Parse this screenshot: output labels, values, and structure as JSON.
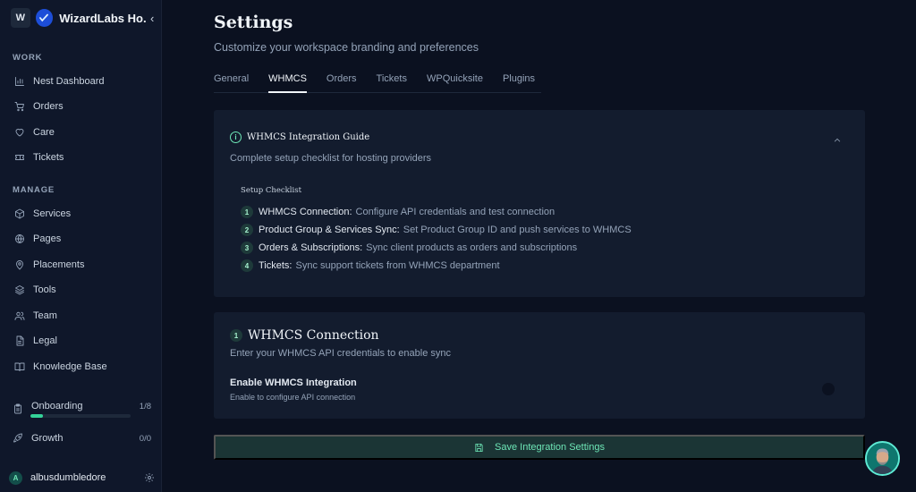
{
  "sidebar": {
    "workspace_badge": "W",
    "workspace_name": "WizardLabs Ho...",
    "collapse_glyph": "‹",
    "sections": {
      "work": "WORK",
      "manage": "MANAGE"
    },
    "work_items": [
      {
        "label": "Nest Dashboard",
        "icon": "bar-chart-icon"
      },
      {
        "label": "Orders",
        "icon": "cart-icon"
      },
      {
        "label": "Care",
        "icon": "heart-icon"
      },
      {
        "label": "Tickets",
        "icon": "ticket-icon"
      }
    ],
    "manage_items": [
      {
        "label": "Services",
        "icon": "box-icon"
      },
      {
        "label": "Pages",
        "icon": "globe-icon"
      },
      {
        "label": "Placements",
        "icon": "map-pin-icon"
      },
      {
        "label": "Tools",
        "icon": "layers-icon"
      },
      {
        "label": "Team",
        "icon": "users-icon"
      },
      {
        "label": "Legal",
        "icon": "file-icon"
      },
      {
        "label": "Knowledge Base",
        "icon": "book-icon"
      }
    ],
    "onboarding": {
      "label": "Onboarding",
      "count": "1/8",
      "progress": 0.125
    },
    "growth": {
      "label": "Growth",
      "count": "0/0"
    },
    "user": {
      "initial": "A",
      "name": "albusdumbledore"
    }
  },
  "header": {
    "title": "Settings",
    "subtitle": "Customize your workspace branding and preferences"
  },
  "tabs": [
    {
      "label": "General",
      "active": false
    },
    {
      "label": "WHMCS",
      "active": true
    },
    {
      "label": "Orders",
      "active": false
    },
    {
      "label": "Tickets",
      "active": false
    },
    {
      "label": "WPQuicksite",
      "active": false
    },
    {
      "label": "Plugins",
      "active": false
    }
  ],
  "guide": {
    "info_glyph": "i",
    "title": "WHMCS Integration Guide",
    "description": "Complete setup checklist for hosting providers",
    "checklist_title": "Setup Checklist",
    "steps": [
      {
        "num": "1",
        "bold": "WHMCS Connection:",
        "text": "Configure API credentials and test connection"
      },
      {
        "num": "2",
        "bold": "Product Group & Services Sync:",
        "text": "Set Product Group ID and push services to WHMCS"
      },
      {
        "num": "3",
        "bold": "Orders & Subscriptions:",
        "text": "Sync client products as orders and subscriptions"
      },
      {
        "num": "4",
        "bold": "Tickets:",
        "text": "Sync support tickets from WHMCS department"
      }
    ]
  },
  "connection": {
    "num": "1",
    "title": "WHMCS Connection",
    "description": "Enter your WHMCS API credentials to enable sync",
    "toggle_label": "Enable WHMCS Integration",
    "toggle_sub": "Enable to configure API connection",
    "enabled": false
  },
  "save_button": {
    "label": "Save Integration Settings"
  },
  "colors": {
    "accent": "#6ee7b7",
    "background": "#0b1120",
    "card": "#131c2e",
    "sidebar": "#0f172a"
  }
}
